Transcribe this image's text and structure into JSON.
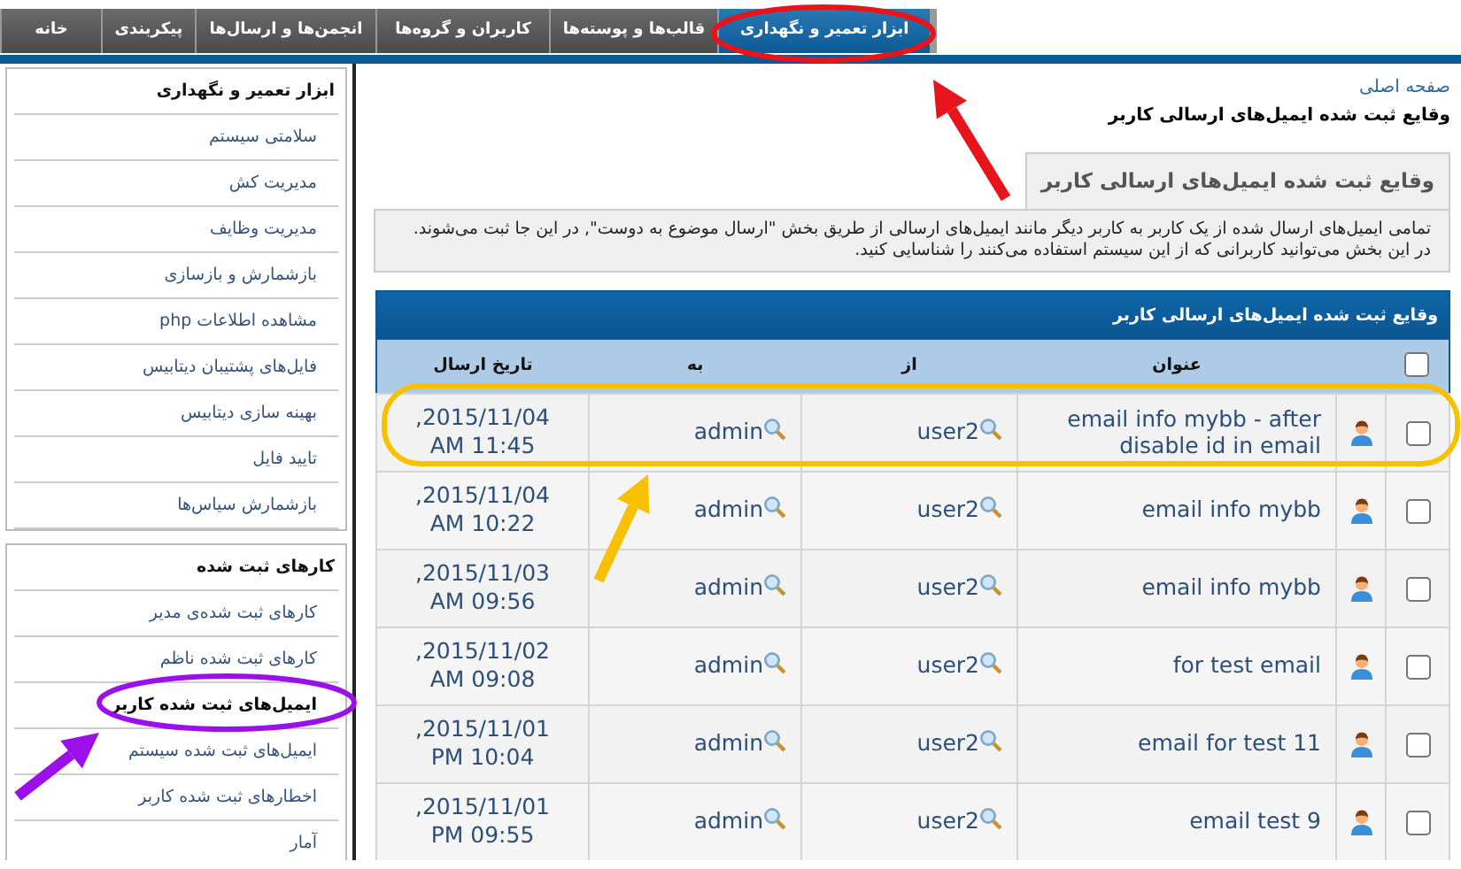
{
  "nav_tabs": [
    {
      "label": "ابزار تعمیر و نگهداری",
      "selected": true
    },
    {
      "label": "قالب‌ها و پوسته‌ها",
      "selected": false
    },
    {
      "label": "کاربران و گروه‌ها",
      "selected": false
    },
    {
      "label": "انجمن‌ها و ارسال‌ها",
      "selected": false
    },
    {
      "label": "پیکربندی",
      "selected": false
    },
    {
      "label": "خانه",
      "selected": false
    }
  ],
  "sidebar": [
    {
      "title": "ابزار تعمیر و نگهداری",
      "items": [
        {
          "label": "سلامتی سیستم",
          "selected": false
        },
        {
          "label": "مدیریت کش",
          "selected": false
        },
        {
          "label": "مدیریت وظایف",
          "selected": false
        },
        {
          "label": "بازشمارش و بازسازی",
          "selected": false
        },
        {
          "label": "مشاهده اطلاعات php",
          "selected": false
        },
        {
          "label": "فایل‌های پشتیبان دیتابیس",
          "selected": false
        },
        {
          "label": "بهینه سازی دیتابیس",
          "selected": false
        },
        {
          "label": "تایید فایل",
          "selected": false
        },
        {
          "label": "بازشمارش سیاس‌ها",
          "selected": false
        }
      ]
    },
    {
      "title": "کارهای ثبت شده",
      "items": [
        {
          "label": "کارهای ثبت شده‌ی مدیر",
          "selected": false
        },
        {
          "label": "کارهای ثبت شده ناظم",
          "selected": false
        },
        {
          "label": "ایمیل‌های ثبت شده کاربر",
          "selected": true
        },
        {
          "label": "ایمیل‌های ثبت شده سیستم",
          "selected": false
        },
        {
          "label": "اخطارهای ثبت شده کاربر",
          "selected": false
        },
        {
          "label": "آمار",
          "selected": false
        }
      ]
    }
  ],
  "breadcrumb": {
    "link": "صفحه اصلی",
    "current": "وقایع ثبت شده ایمیل‌های ارسالی کاربر"
  },
  "page_tab": "وقایع ثبت شده ایمیل‌های ارسالی کاربر",
  "description": [
    "تمامی ایمیل‌های ارسال شده از یک کاربر به کاربر دیگر مانند ایمیل‌های ارسالی از طریق بخش \"ارسال موضوع به دوست\", در این جا ثبت می‌شوند.",
    "در این بخش می‌توانید کاربرانی که از این سیستم استفاده می‌کنند را شناسایی کنید."
  ],
  "table": {
    "title": "وقایع ثبت شده ایمیل‌های ارسالی کاربر",
    "select_all_checked": false,
    "columns": [
      "عنوان",
      "از",
      "به",
      "تاریخ ارسال"
    ],
    "rows": [
      {
        "checked": false,
        "subject": "email info mybb - after disable id in email",
        "from": "user2",
        "to": "admin",
        "date": ",2015/11/04",
        "time": "AM 11:45"
      },
      {
        "checked": false,
        "subject": "email info mybb",
        "from": "user2",
        "to": "admin",
        "date": ",2015/11/04",
        "time": "AM 10:22"
      },
      {
        "checked": false,
        "subject": "email info mybb",
        "from": "user2",
        "to": "admin",
        "date": ",2015/11/03",
        "time": "AM 09:56"
      },
      {
        "checked": false,
        "subject": "for test email",
        "from": "user2",
        "to": "admin",
        "date": ",2015/11/02",
        "time": "AM 09:08"
      },
      {
        "checked": false,
        "subject": "email for test 11",
        "from": "user2",
        "to": "admin",
        "date": ",2015/11/01",
        "time": "PM 10:04"
      },
      {
        "checked": false,
        "subject": "email test 9",
        "from": "user2",
        "to": "admin",
        "date": ",2015/11/01",
        "time": "PM 09:55"
      }
    ]
  },
  "annotations": [
    {
      "color": "#e8141b"
    },
    {
      "color": "#9b10e8"
    },
    {
      "color": "#f7c000"
    }
  ]
}
